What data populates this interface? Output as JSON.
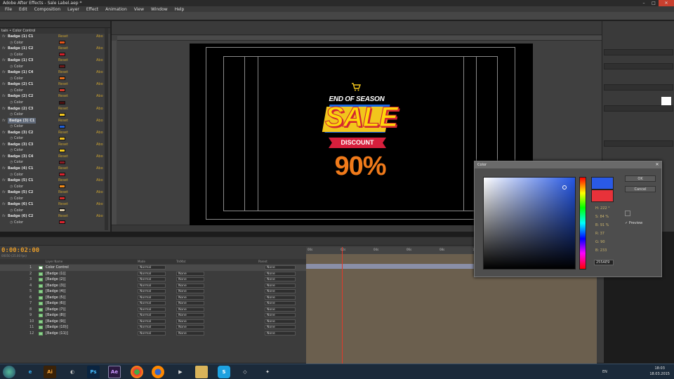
{
  "window": {
    "title": "Adobe After Effects - Sale Label.aep *"
  },
  "menu": [
    "File",
    "Edit",
    "Composition",
    "Layer",
    "Effect",
    "Animation",
    "View",
    "Window",
    "Help"
  ],
  "effect_controls": {
    "header": "tain • Color Control",
    "reset_label": "Reset",
    "about_label": "Abo",
    "color_label": "Color",
    "items": [
      {
        "name": "Badge (1) C1",
        "color": "#e5541a"
      },
      {
        "name": "Badge (1) C2",
        "color": "#d11f2a"
      },
      {
        "name": "Badge (1) C3",
        "color": "#6b1a1a"
      },
      {
        "name": "Badge (1) C4",
        "color": "#e56d1a"
      },
      {
        "name": "Badge (2) C1",
        "color": "#d4382a"
      },
      {
        "name": "Badge (2) C2",
        "color": "#4a1010"
      },
      {
        "name": "Badge (2) C3",
        "color": "#f3c81e"
      },
      {
        "name": "Badge (3) C1",
        "color": "#1f5fd9",
        "selected": true
      },
      {
        "name": "Badge (3) C2",
        "color": "#f0c020"
      },
      {
        "name": "Badge (3) C3",
        "color": "#f4c91c"
      },
      {
        "name": "Badge (3) C4",
        "color": "#8a1b24"
      },
      {
        "name": "Badge (4) C1",
        "color": "#d8222e"
      },
      {
        "name": "Badge (5) C1",
        "color": "#f08a1a"
      },
      {
        "name": "Badge (5) C2",
        "color": "#d62a2a"
      },
      {
        "name": "Badge (6) C1",
        "color": "#d8c8a8"
      },
      {
        "name": "Badge (6) C2",
        "color": "#d8232d"
      }
    ]
  },
  "graphic": {
    "top_text": "END OF SEASON",
    "sale_text": "SALE",
    "discount_text": "DISCOUNT",
    "percent_text": "90%"
  },
  "timeline": {
    "timecode": "0:00:02:00",
    "subtimecode": "00050 (25.00 fps)",
    "columns": {
      "layer_name": "Layer Name",
      "mode": "Mode",
      "trkmat": "TrkMat",
      "parent": "Parent"
    },
    "ruler_ticks": [
      "00s",
      "02s",
      "04s",
      "06s",
      "08s",
      "10s"
    ],
    "layers": [
      {
        "num": "1",
        "name": "Color Control",
        "mode": "Normal",
        "trkmat": "",
        "parent": "None",
        "label": "#ffffff"
      },
      {
        "num": "2",
        "name": "[Badge (1)]",
        "mode": "Normal",
        "trkmat": "None",
        "parent": "None",
        "label": "#8fd18f"
      },
      {
        "num": "3",
        "name": "[Badge (2)]",
        "mode": "Normal",
        "trkmat": "None",
        "parent": "None",
        "label": "#8fd18f"
      },
      {
        "num": "4",
        "name": "[Badge (3)]",
        "mode": "Normal",
        "trkmat": "None",
        "parent": "None",
        "label": "#8fd18f"
      },
      {
        "num": "5",
        "name": "[Badge (4)]",
        "mode": "Normal",
        "trkmat": "None",
        "parent": "None",
        "label": "#8fd18f"
      },
      {
        "num": "6",
        "name": "[Badge (5)]",
        "mode": "Normal",
        "trkmat": "None",
        "parent": "None",
        "label": "#8fd18f"
      },
      {
        "num": "7",
        "name": "[Badge (6)]",
        "mode": "Normal",
        "trkmat": "None",
        "parent": "None",
        "label": "#8fd18f"
      },
      {
        "num": "8",
        "name": "[Badge (7)]",
        "mode": "Normal",
        "trkmat": "None",
        "parent": "None",
        "label": "#8fd18f"
      },
      {
        "num": "9",
        "name": "[Badge (8)]",
        "mode": "Normal",
        "trkmat": "None",
        "parent": "None",
        "label": "#8fd18f"
      },
      {
        "num": "10",
        "name": "[Badge (9)]",
        "mode": "Normal",
        "trkmat": "None",
        "parent": "None",
        "label": "#8fd18f"
      },
      {
        "num": "11",
        "name": "[Badge (10)]",
        "mode": "Normal",
        "trkmat": "None",
        "parent": "None",
        "label": "#8fd18f"
      },
      {
        "num": "12",
        "name": "[Badge (11)]",
        "mode": "Normal",
        "trkmat": "None",
        "parent": "None",
        "label": "#8fd18f"
      }
    ]
  },
  "color_dialog": {
    "title": "Color",
    "ok_label": "OK",
    "cancel_label": "Cancel",
    "preview_label": "Preview",
    "new_color": "#2a5ae6",
    "old_color": "#e8323a",
    "fields": [
      {
        "label": "H:",
        "value": "222 °"
      },
      {
        "label": "S:",
        "value": "84 %"
      },
      {
        "label": "B:",
        "value": "91 %"
      },
      {
        "label": "R:",
        "value": "37"
      },
      {
        "label": "G:",
        "value": "90"
      },
      {
        "label": "B:",
        "value": "233"
      }
    ],
    "hex": "255AE9"
  },
  "taskbar": {
    "lang": "EN",
    "time": "18:03",
    "date": "18.03.2015"
  }
}
